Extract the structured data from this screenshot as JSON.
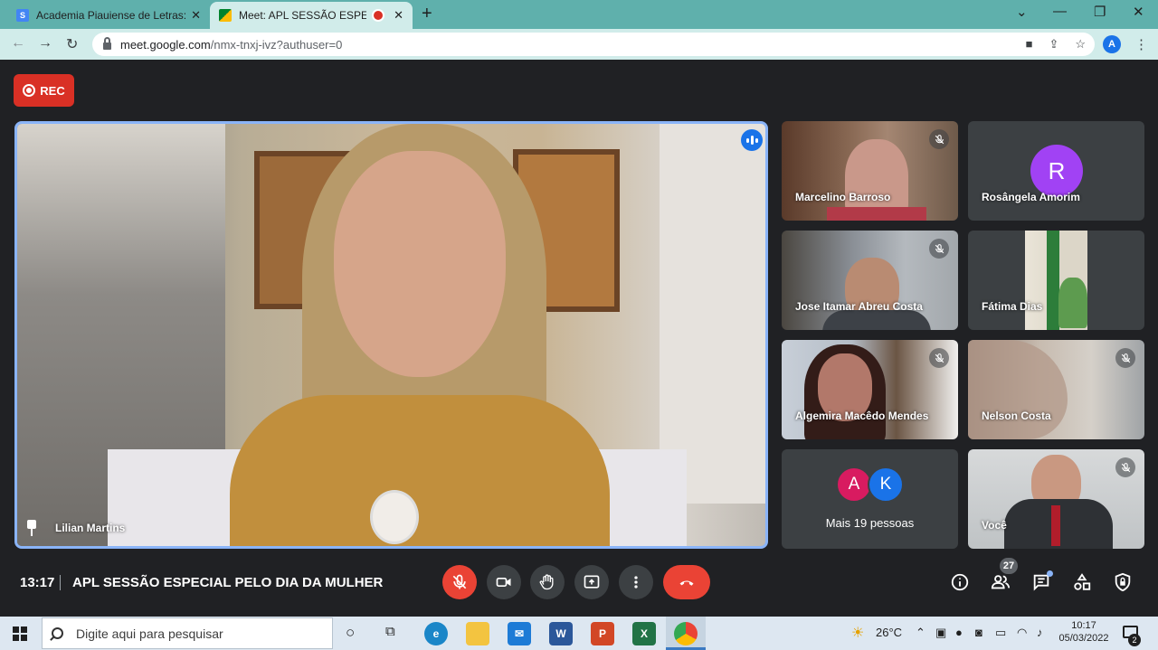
{
  "browser": {
    "tabs": [
      {
        "title": "Academia Piauiense de Letras: ag",
        "favicon": "google-sites-icon",
        "active": false
      },
      {
        "title": "Meet: APL SESSÃO ESPECIAL",
        "favicon": "google-meet-icon",
        "active": true
      }
    ],
    "url_host": "meet.google.com",
    "url_path": "/nmx-tnxj-ivz?authuser=0",
    "profile_initial": "A"
  },
  "meet": {
    "rec_label": "REC",
    "main_speaker": "Lilian Martins",
    "participants": [
      {
        "name": "Marcelino Barroso",
        "muted": true
      },
      {
        "name": "Rosângela Amorim",
        "muted": false,
        "avatar_letter": "R",
        "avatar_color": "#a142f4"
      },
      {
        "name": "Jose Itamar Abreu Costa",
        "muted": true
      },
      {
        "name": "Fátima Dias",
        "muted": false
      },
      {
        "name": "Algemira Macêdo Mendes",
        "muted": true
      },
      {
        "name": "Nelson Costa",
        "muted": true
      },
      {
        "name": "Você",
        "muted": true
      }
    ],
    "more": {
      "avatars": [
        "A",
        "K"
      ],
      "avatar_colors": [
        "#d81b60",
        "#1a73e8"
      ],
      "label": "Mais 19 pessoas"
    },
    "time": "13:17",
    "meeting_title": "APL SESSÃO ESPECIAL PELO DIA DA MULHER",
    "people_count": "27",
    "colors": {
      "end_call": "#ea4335",
      "accent": "#8ab4f8",
      "background": "#202124"
    }
  },
  "taskbar": {
    "search_placeholder": "Digite aqui para pesquisar",
    "temperature": "26°C",
    "time": "10:17",
    "date": "05/03/2022",
    "notification_count": "2"
  }
}
